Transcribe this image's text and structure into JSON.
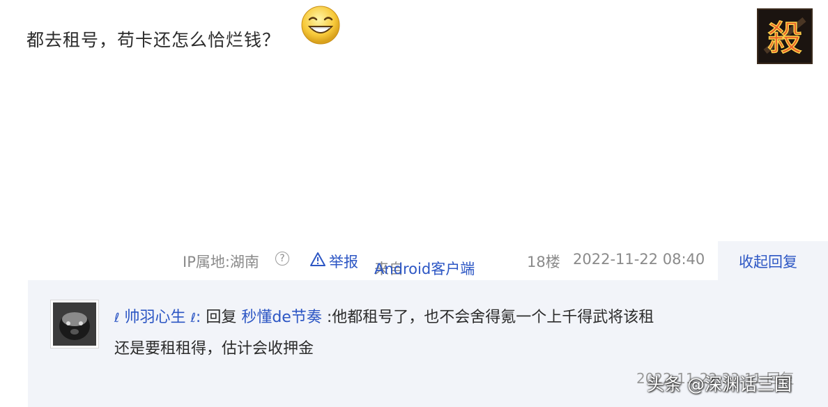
{
  "post": {
    "text": "都去租号，苟卡还怎么恰烂钱？",
    "emoji": "grinning-face-emoji",
    "avatar_glyph": "殺"
  },
  "meta": {
    "ip_location": "IP属地:湖南",
    "report_label": "举报",
    "source_prefix": "来自",
    "source_client": "Android客户端",
    "floor": "18楼",
    "timestamp": "2022-11-22 08:40",
    "collapse_label": "收起回复"
  },
  "reply": {
    "username": "帅羽心生",
    "reply_word": "回复",
    "target_user": "秒懂de节奏",
    "text_line1": ":他都租号了，也不会舍得氪一个上千得武将该租",
    "text_line2": "还是要租租得，估计会收押金",
    "footer": "2022-11-22 22:11 回复"
  },
  "watermark": "头条 @深渊话三国",
  "colors": {
    "link": "#2c56c4",
    "meta_text": "#8a8a8a",
    "reply_bg": "#f2f4f9"
  }
}
